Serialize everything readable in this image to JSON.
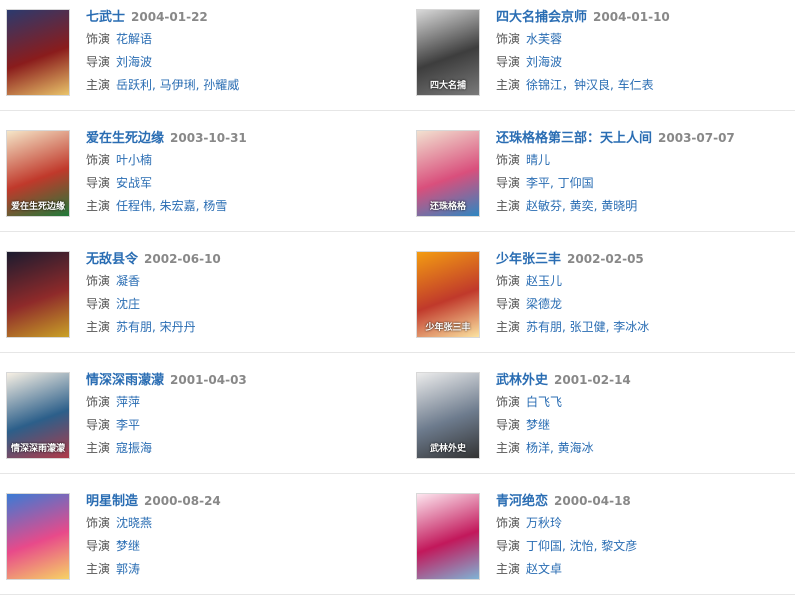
{
  "labels": {
    "role": "饰演",
    "director": "导演",
    "starring": "主演"
  },
  "items": [
    {
      "title": "七武士",
      "date": "2004-01-22",
      "role": "花解语",
      "director": "刘海波",
      "starring": "岳跃利, 马伊琍, 孙耀威",
      "poster_colors": [
        "#2b3a6e",
        "#8a1c1c",
        "#e9c46a"
      ]
    },
    {
      "title": "四大名捕会京师",
      "date": "2004-01-10",
      "role": "水芙蓉",
      "director": "刘海波",
      "starring": "徐锦江，钟汉良, 车仁表",
      "poster_colors": [
        "#d9d9d9",
        "#3d3d3d",
        "#7a7a7a"
      ],
      "poster_text": "四大名捕"
    },
    {
      "title": "爱在生死边缘",
      "date": "2003-10-31",
      "role": "叶小楠",
      "director": "安战军",
      "starring": "任程伟, 朱宏嘉, 杨雪",
      "poster_colors": [
        "#f5e6c8",
        "#c0392b",
        "#1f7a3a"
      ],
      "poster_text": "爱在生死边缘"
    },
    {
      "title": "还珠格格第三部：天上人间",
      "date": "2003-07-07",
      "role": "晴儿",
      "director": "李平, 丁仰国",
      "starring": "赵敏芬, 黄奕, 黄晓明",
      "poster_colors": [
        "#f2e1d0",
        "#d94f7c",
        "#2e86c1"
      ],
      "poster_text": "还珠格格"
    },
    {
      "title": "无敌县令",
      "date": "2002-06-10",
      "role": "凝香",
      "director": "沈庄",
      "starring": "苏有朋, 宋丹丹",
      "poster_colors": [
        "#1b1b2f",
        "#8e2a2a",
        "#c9a227"
      ]
    },
    {
      "title": "少年张三丰",
      "date": "2002-02-05",
      "role": "赵玉儿",
      "director": "梁德龙",
      "starring": "苏有朋, 张卫健, 李冰冰",
      "poster_colors": [
        "#f39c12",
        "#c0392b",
        "#fbe3a1"
      ],
      "poster_text": "少年张三丰"
    },
    {
      "title": "情深深雨濛濛",
      "date": "2001-04-03",
      "role": "萍萍",
      "director": "李平",
      "starring": "寇振海",
      "poster_colors": [
        "#f7f0e4",
        "#2c5f8a",
        "#b03a48"
      ],
      "poster_text": "情深深雨濛濛"
    },
    {
      "title": "武林外史",
      "date": "2001-02-14",
      "role": "白飞飞",
      "director": "梦继",
      "starring": "杨洋, 黄海冰",
      "poster_colors": [
        "#ececec",
        "#6d7b8d",
        "#333333"
      ],
      "poster_text": "武林外史"
    },
    {
      "title": "明星制造",
      "date": "2000-08-24",
      "role": "沈晓燕",
      "director": "梦继",
      "starring": "郭涛",
      "poster_colors": [
        "#3a7bd5",
        "#e84a8a",
        "#f6d365"
      ]
    },
    {
      "title": "青河绝恋",
      "date": "2000-04-18",
      "role": "万秋玲",
      "director": "丁仰国, 沈怡, 黎文彦",
      "starring": "赵文卓",
      "poster_colors": [
        "#fde6ef",
        "#c2185b",
        "#7fb3d5"
      ]
    }
  ]
}
